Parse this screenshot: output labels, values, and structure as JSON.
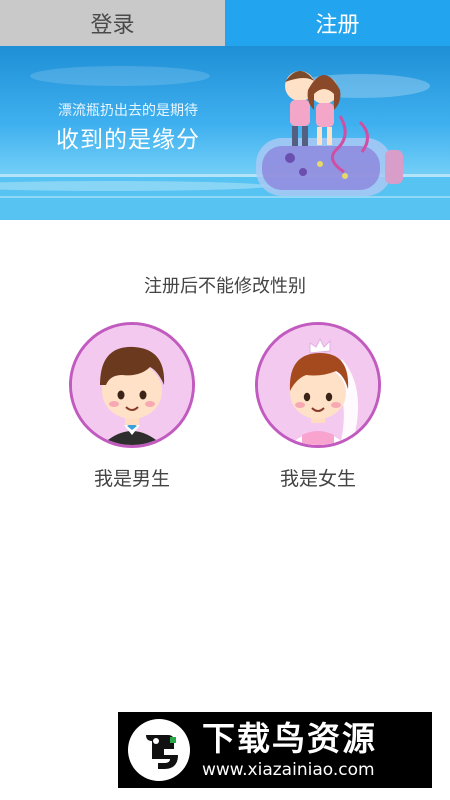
{
  "tabs": {
    "login": "登录",
    "register": "注册",
    "active": "register"
  },
  "banner": {
    "line1": "漂流瓶扔出去的是期待",
    "line2": "收到的是缘分"
  },
  "notice": "注册后不能修改性别",
  "genders": [
    {
      "label": "我是男生",
      "icon": "boy-avatar-icon"
    },
    {
      "label": "我是女生",
      "icon": "girl-avatar-icon"
    }
  ],
  "watermark": {
    "title": "下载鸟资源",
    "url": "www.xiazainiao.com"
  },
  "colors": {
    "tab_active": "#23a4ee",
    "tab_inactive": "#c9c9c9",
    "avatar_border": "#c25bbf",
    "avatar_bg": "#f3c9ef"
  }
}
